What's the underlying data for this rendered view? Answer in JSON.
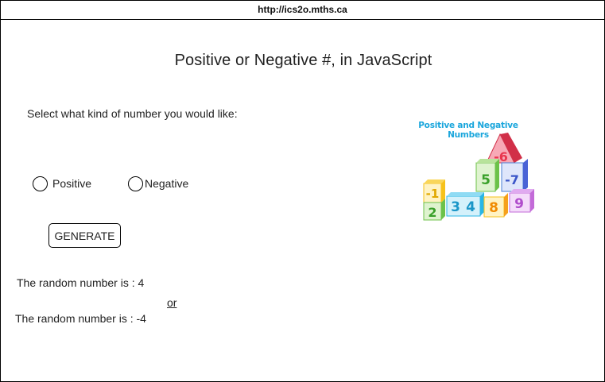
{
  "browser": {
    "url": "http://ics2o.mths.ca"
  },
  "page": {
    "title": "Positive or Negative #, in JavaScript",
    "prompt": "Select what kind of number you would like:",
    "options": [
      {
        "label": "Positive",
        "selected": false
      },
      {
        "label": "Negative",
        "selected": false
      }
    ],
    "generate_button": "GENERATE",
    "result_positive": "The random number is : 4",
    "or_text": "or",
    "result_negative": "The random number is : -4"
  },
  "illustration": {
    "title": "Positive and Negative Numbers",
    "blocks": [
      "-6",
      "5",
      "-7",
      "-1",
      "2",
      "3",
      "4",
      "8",
      "9"
    ],
    "colors": {
      "title": "#1aa6dc",
      "red": "#e8364e",
      "green": "#6cc24a",
      "blue": "#4a7fd6",
      "yellow": "#f6c21b",
      "cyan": "#29b6e6",
      "purple": "#c36bd8"
    }
  }
}
